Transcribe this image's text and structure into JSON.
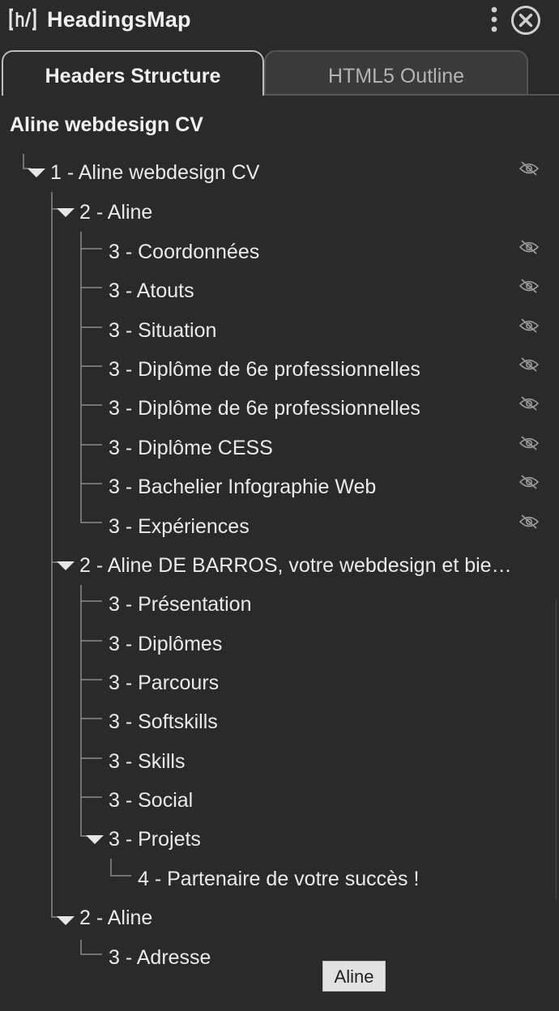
{
  "header": {
    "app_title": "HeadingsMap",
    "logo_icon": "headingsmap-logo-icon",
    "menu_icon": "kebab-menu-icon",
    "close_icon": "close-circle-icon"
  },
  "tabs": [
    {
      "label": "Headers Structure",
      "active": true
    },
    {
      "label": "HTML5 Outline",
      "active": false
    }
  ],
  "document_title": "Aline webdesign CV",
  "tree": {
    "n1": "1 - Aline webdesign CV",
    "n2a": "2 - Aline",
    "n3a1": "3 - Coordonnées",
    "n3a2": "3 - Atouts",
    "n3a3": "3 - Situation",
    "n3a4": "3 - Diplôme de 6e professionnelles",
    "n3a5": "3 - Diplôme de 6e professionnelles",
    "n3a6": "3 - Diplôme CESS",
    "n3a7": "3 - Bachelier Infographie Web",
    "n3a8": "3 - Expériences",
    "n2b": "2 - Aline DE BARROS, votre webdesign et bie…",
    "n3b1": "3 -  Présentation",
    "n3b2": "3 -  Diplômes",
    "n3b3": "3 -  Parcours",
    "n3b4": "3 -  Softskills",
    "n3b5": "3 -  Skills",
    "n3b6": "3 -  Social",
    "n3b7": "3 -  Projets",
    "n4": "4 - Partenaire de votre succès !",
    "n2c": "2 - Aline",
    "n3c1": "3 - Adresse"
  },
  "tooltip": "Aline",
  "colors": {
    "background": "#2a2a2a",
    "text": "#eaeaea",
    "tree_line": "#8a8a8a",
    "hidden_icon": "#9a9a9a"
  }
}
